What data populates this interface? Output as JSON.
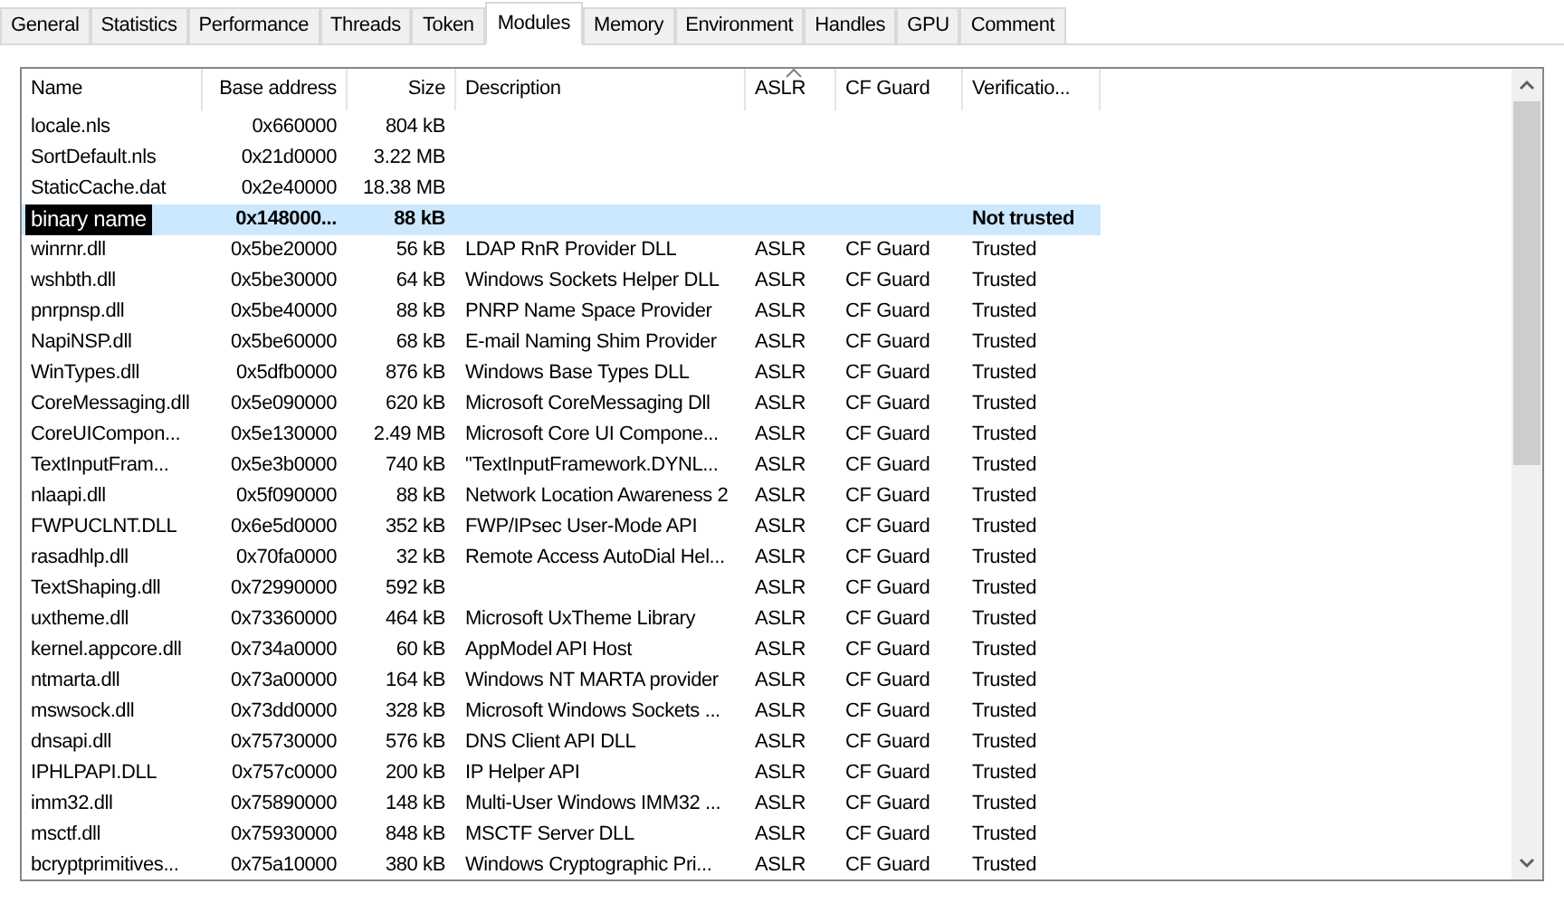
{
  "tabs": [
    {
      "label": "General",
      "selected": false
    },
    {
      "label": "Statistics",
      "selected": false
    },
    {
      "label": "Performance",
      "selected": false
    },
    {
      "label": "Threads",
      "selected": false
    },
    {
      "label": "Token",
      "selected": false
    },
    {
      "label": "Modules",
      "selected": true
    },
    {
      "label": "Memory",
      "selected": false
    },
    {
      "label": "Environment",
      "selected": false
    },
    {
      "label": "Handles",
      "selected": false
    },
    {
      "label": "GPU",
      "selected": false
    },
    {
      "label": "Comment",
      "selected": false
    }
  ],
  "table": {
    "columns": [
      {
        "label": "Name",
        "sorted": false
      },
      {
        "label": "Base address",
        "sorted": false
      },
      {
        "label": "Size",
        "sorted": false
      },
      {
        "label": "Description",
        "sorted": false
      },
      {
        "label": "ASLR",
        "sorted": true
      },
      {
        "label": "CF Guard",
        "sorted": false
      },
      {
        "label": "Verificatio...",
        "sorted": false
      }
    ],
    "rows": [
      {
        "selected": false,
        "cells": [
          "locale.nls",
          "0x660000",
          "804 kB",
          "",
          "",
          "",
          ""
        ]
      },
      {
        "selected": false,
        "cells": [
          "SortDefault.nls",
          "0x21d0000",
          "3.22 MB",
          "",
          "",
          "",
          ""
        ]
      },
      {
        "selected": false,
        "cells": [
          "StaticCache.dat",
          "0x2e40000",
          "18.38 MB",
          "",
          "",
          "",
          ""
        ]
      },
      {
        "selected": true,
        "cells": [
          "binary name",
          "0x148000...",
          "88 kB",
          "",
          "",
          "",
          "Not trusted"
        ]
      },
      {
        "selected": false,
        "cells": [
          "winrnr.dll",
          "0x5be20000",
          "56 kB",
          "LDAP RnR Provider DLL",
          "ASLR",
          "CF Guard",
          "Trusted"
        ]
      },
      {
        "selected": false,
        "cells": [
          "wshbth.dll",
          "0x5be30000",
          "64 kB",
          "Windows Sockets Helper DLL",
          "ASLR",
          "CF Guard",
          "Trusted"
        ]
      },
      {
        "selected": false,
        "cells": [
          "pnrpnsp.dll",
          "0x5be40000",
          "88 kB",
          "PNRP Name Space Provider",
          "ASLR",
          "CF Guard",
          "Trusted"
        ]
      },
      {
        "selected": false,
        "cells": [
          "NapiNSP.dll",
          "0x5be60000",
          "68 kB",
          "E-mail Naming Shim Provider",
          "ASLR",
          "CF Guard",
          "Trusted"
        ]
      },
      {
        "selected": false,
        "cells": [
          "WinTypes.dll",
          "0x5dfb0000",
          "876 kB",
          "Windows Base Types DLL",
          "ASLR",
          "CF Guard",
          "Trusted"
        ]
      },
      {
        "selected": false,
        "cells": [
          "CoreMessaging.dll",
          "0x5e090000",
          "620 kB",
          "Microsoft CoreMessaging Dll",
          "ASLR",
          "CF Guard",
          "Trusted"
        ]
      },
      {
        "selected": false,
        "cells": [
          "CoreUICompon...",
          "0x5e130000",
          "2.49 MB",
          "Microsoft Core UI Compone...",
          "ASLR",
          "CF Guard",
          "Trusted"
        ]
      },
      {
        "selected": false,
        "cells": [
          "TextInputFram...",
          "0x5e3b0000",
          "740 kB",
          "\"TextInputFramework.DYNL...",
          "ASLR",
          "CF Guard",
          "Trusted"
        ]
      },
      {
        "selected": false,
        "cells": [
          "nlaapi.dll",
          "0x5f090000",
          "88 kB",
          "Network Location Awareness 2",
          "ASLR",
          "CF Guard",
          "Trusted"
        ]
      },
      {
        "selected": false,
        "cells": [
          "FWPUCLNT.DLL",
          "0x6e5d0000",
          "352 kB",
          "FWP/IPsec User-Mode API",
          "ASLR",
          "CF Guard",
          "Trusted"
        ]
      },
      {
        "selected": false,
        "cells": [
          "rasadhlp.dll",
          "0x70fa0000",
          "32 kB",
          "Remote Access AutoDial Hel...",
          "ASLR",
          "CF Guard",
          "Trusted"
        ]
      },
      {
        "selected": false,
        "cells": [
          "TextShaping.dll",
          "0x72990000",
          "592 kB",
          "",
          "ASLR",
          "CF Guard",
          "Trusted"
        ]
      },
      {
        "selected": false,
        "cells": [
          "uxtheme.dll",
          "0x73360000",
          "464 kB",
          "Microsoft UxTheme Library",
          "ASLR",
          "CF Guard",
          "Trusted"
        ]
      },
      {
        "selected": false,
        "cells": [
          "kernel.appcore.dll",
          "0x734a0000",
          "60 kB",
          "AppModel API Host",
          "ASLR",
          "CF Guard",
          "Trusted"
        ]
      },
      {
        "selected": false,
        "cells": [
          "ntmarta.dll",
          "0x73a00000",
          "164 kB",
          "Windows NT MARTA provider",
          "ASLR",
          "CF Guard",
          "Trusted"
        ]
      },
      {
        "selected": false,
        "cells": [
          "mswsock.dll",
          "0x73dd0000",
          "328 kB",
          "Microsoft Windows Sockets ...",
          "ASLR",
          "CF Guard",
          "Trusted"
        ]
      },
      {
        "selected": false,
        "cells": [
          "dnsapi.dll",
          "0x75730000",
          "576 kB",
          "DNS Client API DLL",
          "ASLR",
          "CF Guard",
          "Trusted"
        ]
      },
      {
        "selected": false,
        "cells": [
          "IPHLPAPI.DLL",
          "0x757c0000",
          "200 kB",
          "IP Helper API",
          "ASLR",
          "CF Guard",
          "Trusted"
        ]
      },
      {
        "selected": false,
        "cells": [
          "imm32.dll",
          "0x75890000",
          "148 kB",
          "Multi-User Windows IMM32 ...",
          "ASLR",
          "CF Guard",
          "Trusted"
        ]
      },
      {
        "selected": false,
        "cells": [
          "msctf.dll",
          "0x75930000",
          "848 kB",
          "MSCTF Server DLL",
          "ASLR",
          "CF Guard",
          "Trusted"
        ]
      },
      {
        "selected": false,
        "cells": [
          "bcryptprimitives...",
          "0x75a10000",
          "380 kB",
          "Windows Cryptographic Pri...",
          "ASLR",
          "CF Guard",
          "Trusted"
        ]
      }
    ]
  }
}
